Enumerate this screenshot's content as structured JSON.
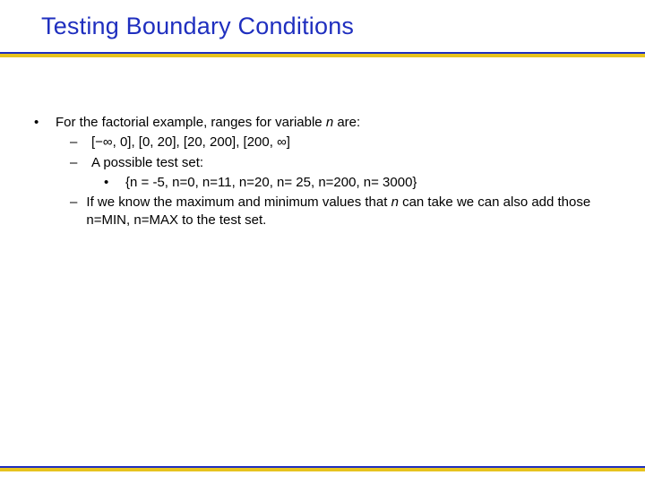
{
  "title": "Testing Boundary Conditions",
  "bullet": {
    "intro_a": "For the factorial example, ranges for variable ",
    "intro_var": "n",
    "intro_b": " are:",
    "ranges": "[−∞, 0], [0, 20], [20, 200], [200, ∞]",
    "possible": "A possible test set:",
    "testset": "{n = -5, n=0, n=11, n=20, n= 25, n=200, n= 3000}",
    "minmax_a": "If we know the maximum and minimum values that ",
    "minmax_var": "n",
    "minmax_b": " can take we can also add those n=MIN, n=MAX to the test set."
  },
  "glyph": {
    "dot": "•",
    "dash": "–"
  }
}
